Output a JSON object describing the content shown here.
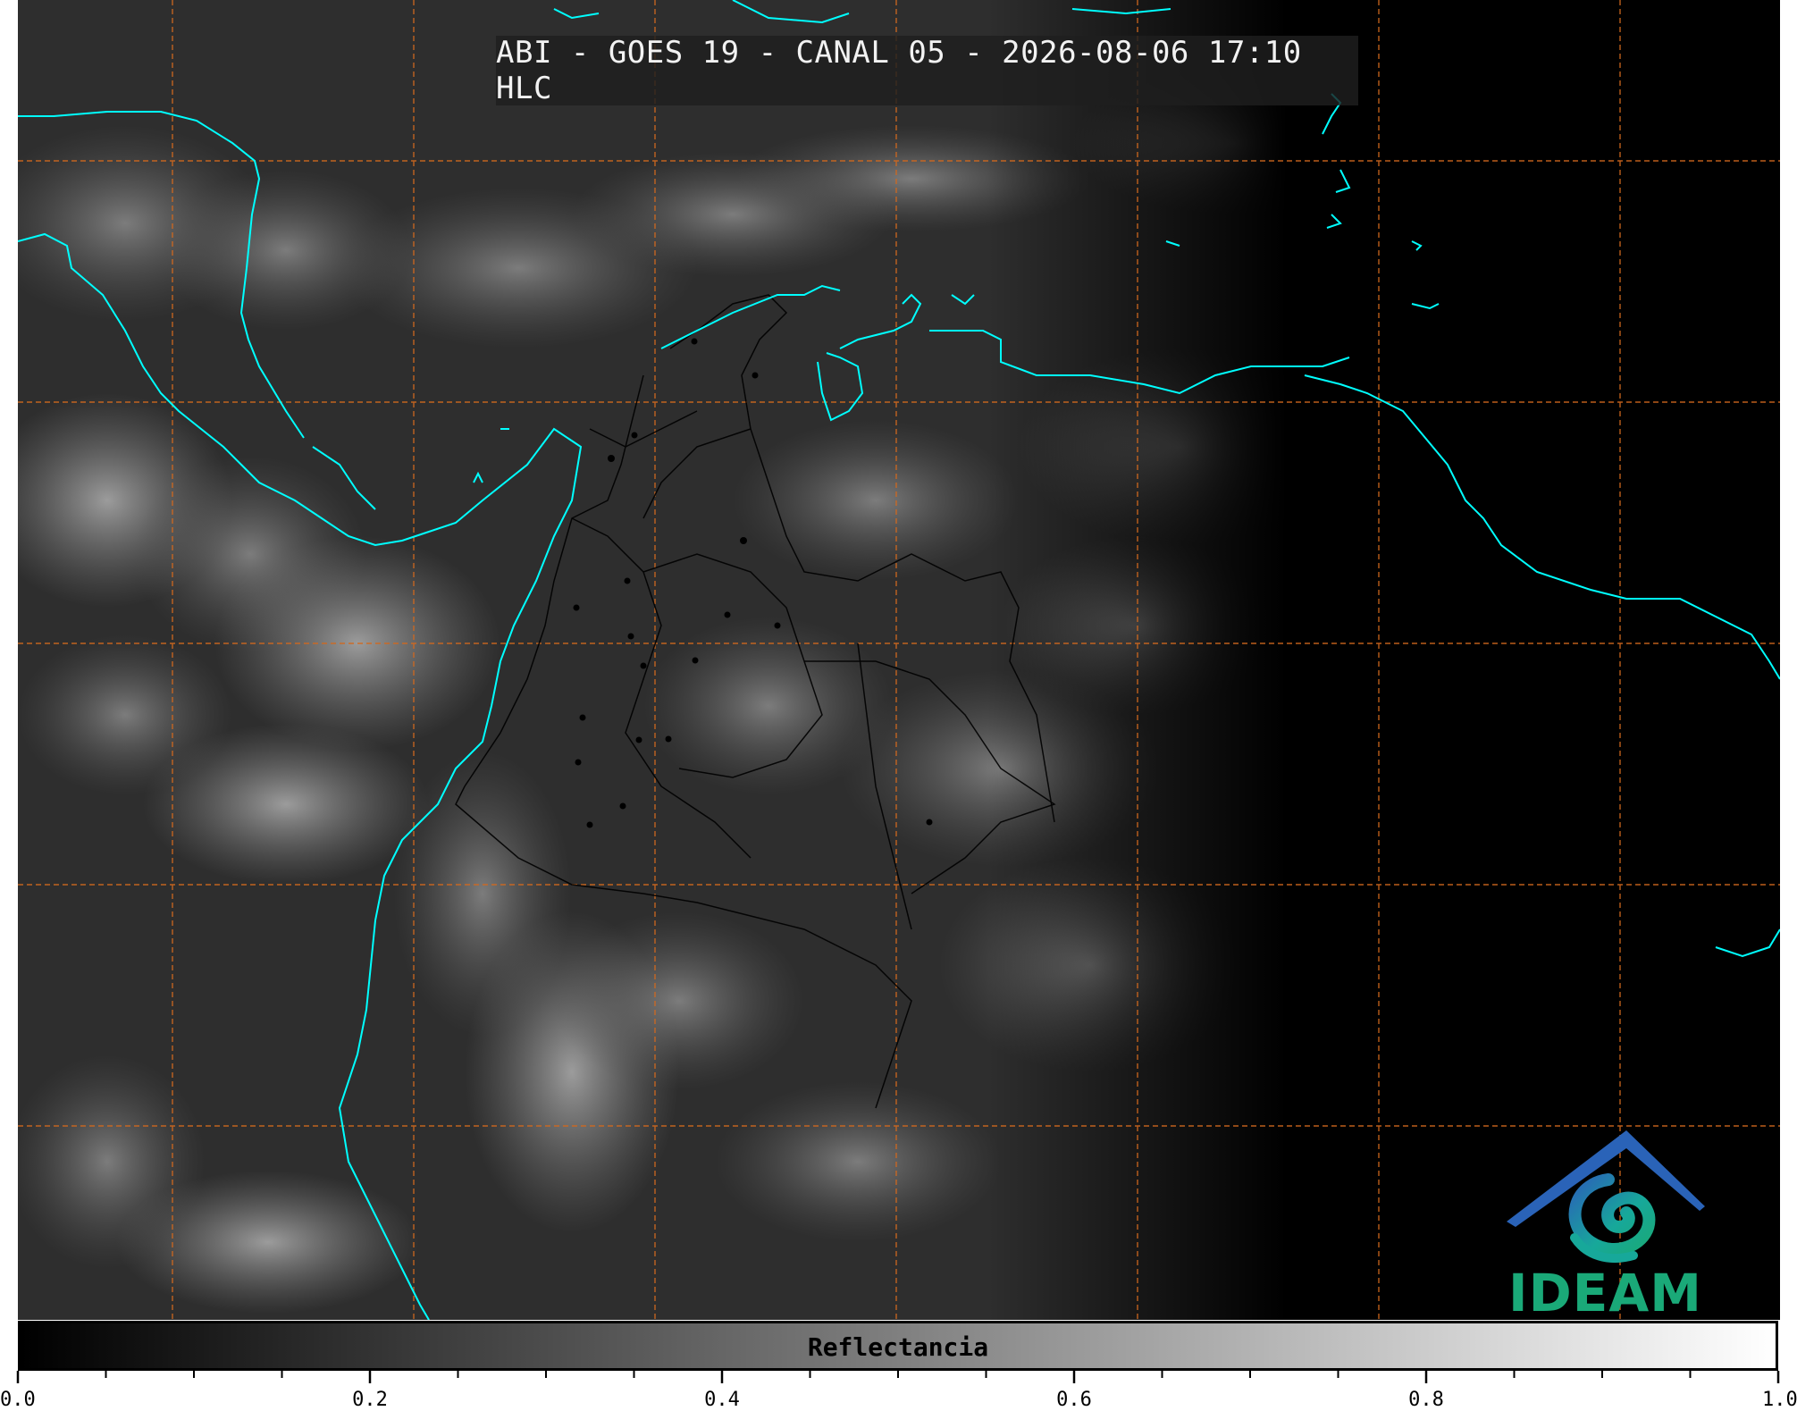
{
  "title": "ABI - GOES 19 - CANAL 05 - 2026-08-06 17:10 HLC",
  "logo": {
    "text": "IDEAM",
    "colors": {
      "blue": "#2a63b8",
      "teal": "#17a89a",
      "green": "#1aa978"
    }
  },
  "colorbar": {
    "label": "Reflectancia",
    "min": 0.0,
    "max": 1.0,
    "tick_labels": [
      "0.0",
      "0.2",
      "0.4",
      "0.6",
      "0.8",
      "1.0"
    ],
    "minor_tick_step": 0.05,
    "colormap": [
      "#000000",
      "#ffffff"
    ]
  },
  "map": {
    "coastline_color": "#00ffff",
    "border_color": "#000000",
    "gridline_color": "#d2691e",
    "gridline_style": "dashed"
  }
}
